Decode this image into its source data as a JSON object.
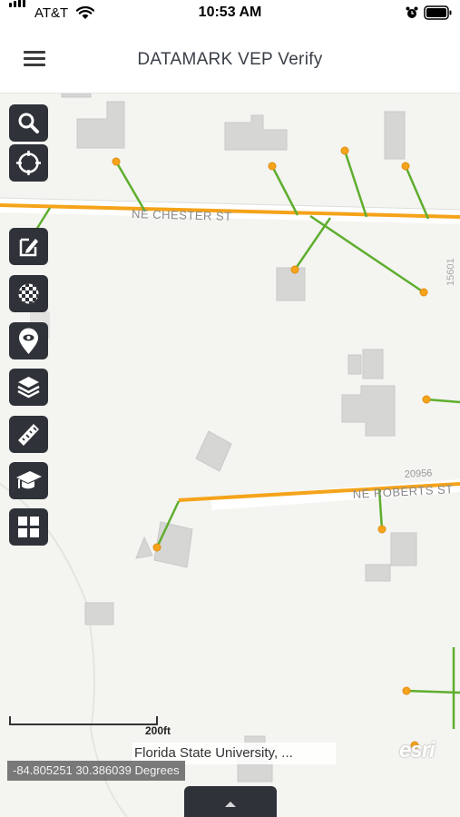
{
  "status_bar": {
    "carrier": "AT&T",
    "time": "10:53 AM"
  },
  "app_bar": {
    "title": "DATAMARK VEP Verify",
    "menu_icon": "hamburger-menu-icon"
  },
  "map": {
    "street_labels": [
      "NE CHESTER ST",
      "NE ROBERTS ST"
    ],
    "address_labels": [
      "20956",
      "15601"
    ],
    "toolbar": [
      {
        "name": "search",
        "icon": "search-icon"
      },
      {
        "name": "locate",
        "icon": "locate-crosshair-icon"
      },
      {
        "name": "edit",
        "icon": "edit-icon"
      },
      {
        "name": "basemap",
        "icon": "basemap-checker-icon"
      },
      {
        "name": "visibility",
        "icon": "eye-pin-icon"
      },
      {
        "name": "layers",
        "icon": "layers-icon"
      },
      {
        "name": "measure",
        "icon": "ruler-icon"
      },
      {
        "name": "graduation",
        "icon": "graduation-cap-icon"
      },
      {
        "name": "grid",
        "icon": "grid-icon"
      }
    ],
    "scale_label": "200ft",
    "attribution": "Florida State University, ...",
    "coordinates": "-84.805251 30.386039 Degrees",
    "esri_logo": "esri",
    "colors": {
      "road": "#f5a31a",
      "connector": "#5fae2e",
      "point": "#f5a31a",
      "building": "#d6d6d4"
    }
  },
  "bottom_panel": {
    "icon": "chevron-up-icon"
  }
}
